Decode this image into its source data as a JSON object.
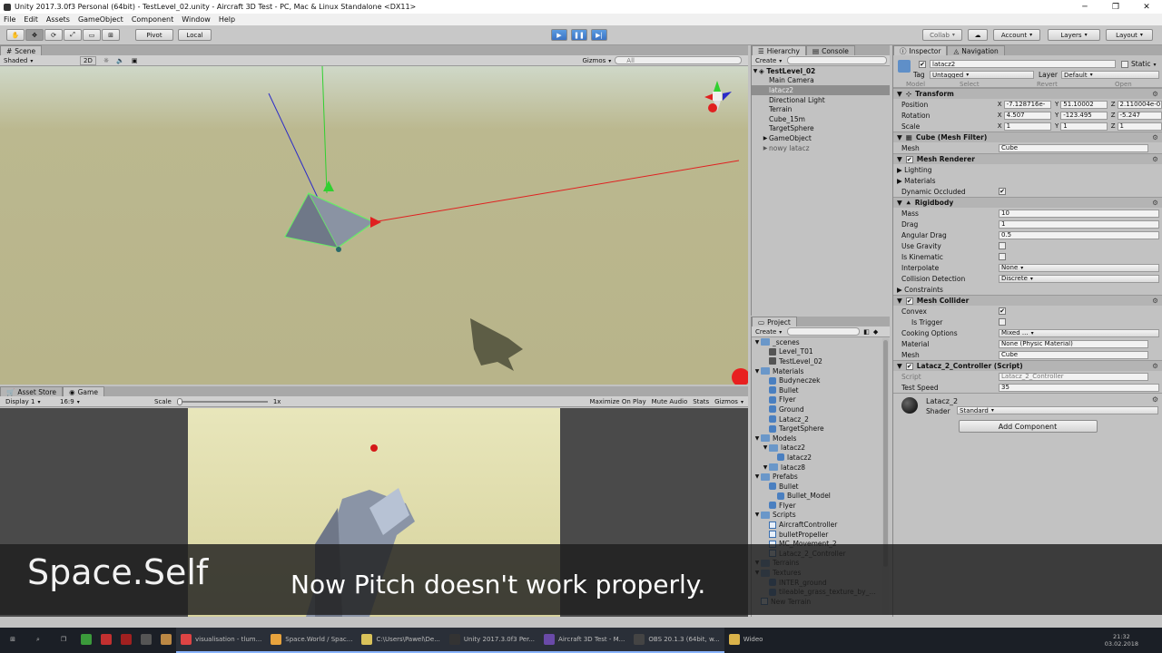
{
  "window": {
    "title": "Unity 2017.3.0f3 Personal (64bit) - TestLevel_02.unity - Aircraft 3D Test - PC, Mac & Linux Standalone <DX11>"
  },
  "menu": [
    "File",
    "Edit",
    "Assets",
    "GameObject",
    "Component",
    "Window",
    "Help"
  ],
  "toolbar": {
    "pivot": "Pivot",
    "local": "Local",
    "collab": "Collab",
    "account": "Account",
    "layers": "Layers",
    "layout": "Layout"
  },
  "scene": {
    "tab": "Scene",
    "shading": "Shaded",
    "mode2d": "2D",
    "gizmos": "Gizmos",
    "search": "All"
  },
  "game": {
    "tabs": [
      "Asset Store",
      "Game"
    ],
    "display": "Display 1",
    "aspect": "16:9",
    "scale_label": "Scale",
    "scale_value": "1x",
    "max": "Maximize On Play",
    "mute": "Mute Audio",
    "stats": "Stats",
    "gizmos": "Gizmos"
  },
  "hierarchy": {
    "tabs": [
      "Hierarchy",
      "Console"
    ],
    "create": "Create",
    "root": "TestLevel_02",
    "items": [
      "Main Camera",
      "latacz2",
      "Directional Light",
      "Terrain",
      "Cube_15m",
      "TargetSphere",
      "GameObject",
      "nowy latacz"
    ]
  },
  "project": {
    "tab": "Project",
    "create": "Create",
    "tree": [
      {
        "label": "_scenes",
        "depth": 0,
        "kind": "folder"
      },
      {
        "label": "Level_T01",
        "depth": 1,
        "kind": "scene"
      },
      {
        "label": "TestLevel_02",
        "depth": 1,
        "kind": "scene"
      },
      {
        "label": "Materials",
        "depth": 0,
        "kind": "folder"
      },
      {
        "label": "Budyneczek",
        "depth": 1,
        "kind": "mat"
      },
      {
        "label": "Bullet",
        "depth": 1,
        "kind": "mat"
      },
      {
        "label": "Flyer",
        "depth": 1,
        "kind": "mat"
      },
      {
        "label": "Ground",
        "depth": 1,
        "kind": "mat"
      },
      {
        "label": "Latacz_2",
        "depth": 1,
        "kind": "mat"
      },
      {
        "label": "TargetSphere",
        "depth": 1,
        "kind": "mat"
      },
      {
        "label": "Models",
        "depth": 0,
        "kind": "folder"
      },
      {
        "label": "latacz2",
        "depth": 1,
        "kind": "folder"
      },
      {
        "label": "latacz2",
        "depth": 2,
        "kind": "mat"
      },
      {
        "label": "latacz8",
        "depth": 1,
        "kind": "folder"
      },
      {
        "label": "Prefabs",
        "depth": 0,
        "kind": "folder"
      },
      {
        "label": "Bullet",
        "depth": 1,
        "kind": "mat"
      },
      {
        "label": "Bullet_Model",
        "depth": 2,
        "kind": "mat"
      },
      {
        "label": "Flyer",
        "depth": 1,
        "kind": "mat"
      },
      {
        "label": "Scripts",
        "depth": 0,
        "kind": "folder"
      },
      {
        "label": "AircraftController",
        "depth": 1,
        "kind": "script"
      },
      {
        "label": "bulletPropeller",
        "depth": 1,
        "kind": "script"
      },
      {
        "label": "MC_Movement_2",
        "depth": 1,
        "kind": "script"
      },
      {
        "label": "Latacz_2_Controller",
        "depth": 1,
        "kind": "script"
      },
      {
        "label": "Terrains",
        "depth": 0,
        "kind": "folder"
      },
      {
        "label": "Textures",
        "depth": 0,
        "kind": "folder"
      },
      {
        "label": "INTER_ground",
        "depth": 1,
        "kind": "mat"
      },
      {
        "label": "tileable_grass_texture_by_...",
        "depth": 1,
        "kind": "mat"
      },
      {
        "label": "New Terrain",
        "depth": 0,
        "kind": "script"
      }
    ]
  },
  "inspector": {
    "tabs": [
      "Inspector",
      "Navigation"
    ],
    "name": "latacz2",
    "static": "Static",
    "tag_label": "Tag",
    "tag": "Untagged",
    "layer_label": "Layer",
    "layer": "Default",
    "model_label": "Model",
    "select": "Select",
    "revert": "Revert",
    "open": "Open",
    "transform": {
      "title": "Transform",
      "position": {
        "label": "Position",
        "x": "-7.128716e-",
        "y": "51.10002",
        "z": "2.110004e-0"
      },
      "rotation": {
        "label": "Rotation",
        "x": "4.507",
        "y": "-123.495",
        "z": "-5.247"
      },
      "scale": {
        "label": "Scale",
        "x": "1",
        "y": "1",
        "z": "1"
      }
    },
    "meshfilter": {
      "title": "Cube (Mesh Filter)",
      "mesh_label": "Mesh",
      "mesh": "Cube"
    },
    "meshrenderer": {
      "title": "Mesh Renderer",
      "lighting": "Lighting",
      "materials": "Materials",
      "occluded": "Dynamic Occluded"
    },
    "rigidbody": {
      "title": "Rigidbody",
      "props": [
        {
          "label": "Mass",
          "value": "10",
          "type": "field"
        },
        {
          "label": "Drag",
          "value": "1",
          "type": "field"
        },
        {
          "label": "Angular Drag",
          "value": "0.5",
          "type": "field"
        },
        {
          "label": "Use Gravity",
          "value": "",
          "type": "check"
        },
        {
          "label": "Is Kinematic",
          "value": "",
          "type": "check"
        },
        {
          "label": "Interpolate",
          "value": "None",
          "type": "drop"
        },
        {
          "label": "Collision Detection",
          "value": "Discrete",
          "type": "drop"
        }
      ],
      "constraints": "Constraints"
    },
    "meshcollider": {
      "title": "Mesh Collider",
      "convex": "Convex",
      "trigger": "Is Trigger",
      "cooking_label": "Cooking Options",
      "cooking": "Mixed ...",
      "material_label": "Material",
      "material": "None (Physic Material)",
      "mesh_label": "Mesh",
      "mesh": "Cube"
    },
    "script": {
      "title": "Latacz_2_Controller (Script)",
      "script_label": "Script",
      "script": "Latacz_2_Controller",
      "speed_label": "Test Speed",
      "speed": "35"
    },
    "material": {
      "name": "Latacz_2",
      "shader_label": "Shader",
      "shader": "Standard"
    },
    "add_component": "Add Component"
  },
  "captions": {
    "left": "Space.Self",
    "main": "Now Pitch doesn't work properly."
  },
  "taskbar": {
    "items": [
      "visualisation - tlum...",
      "Space.World / Spac...",
      "C:\\Users\\Pawel\\De...",
      "Unity 2017.3.0f3 Per...",
      "Aircraft 3D Test - M...",
      "OBS 20.1.3 (64bit, w...",
      "Wideo"
    ],
    "time": "21:32",
    "date": "03.02.2018"
  },
  "colors": {
    "play": "#3a73c4",
    "selection": "#8e8e8e",
    "caption_bg": "#1e1e1e",
    "axis_x": "#e02020",
    "axis_y": "#30d030",
    "axis_z": "#2020c0"
  }
}
